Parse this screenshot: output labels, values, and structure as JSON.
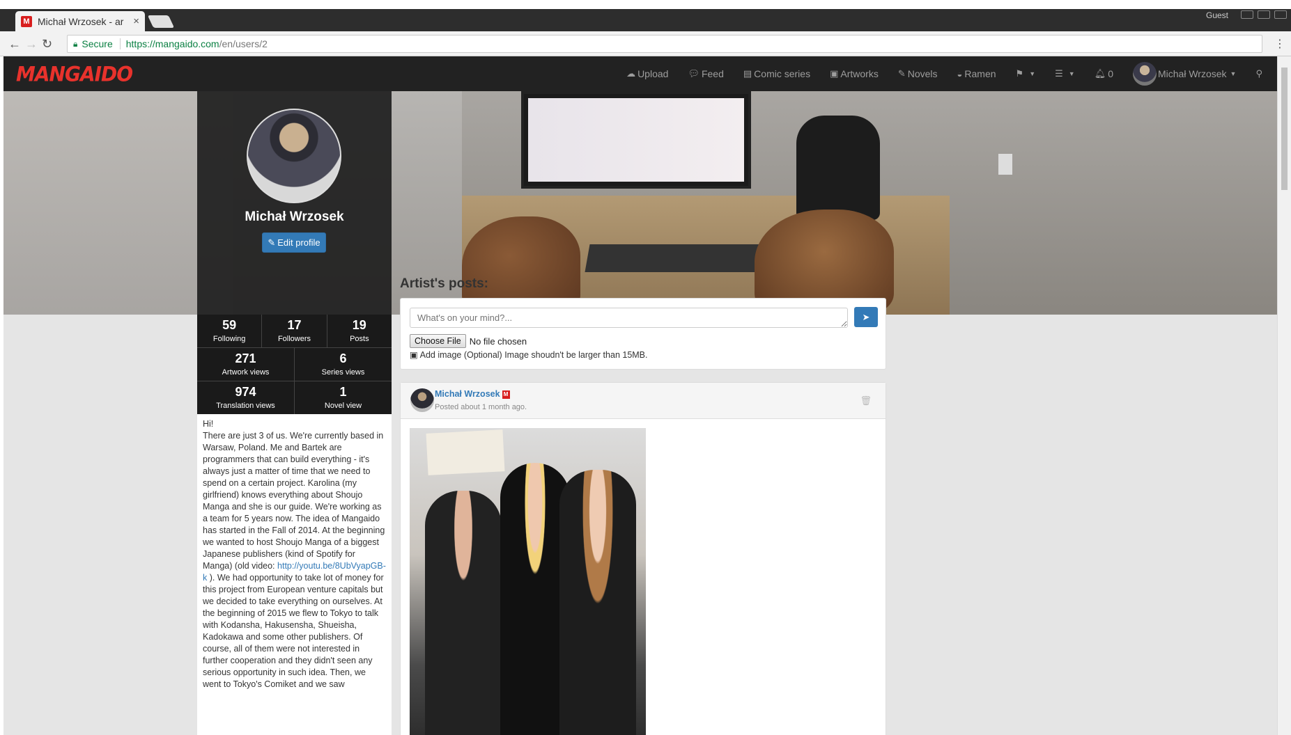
{
  "browser": {
    "tab_title": "Michał Wrzosek - ar",
    "tab_favicon": "M",
    "close_glyph": "×",
    "guest_label": "Guest",
    "secure_label": "Secure",
    "url_host": "https://mangaido.com",
    "url_path": "/en/users/2"
  },
  "nav": {
    "logo": "MANGAIDO",
    "items": [
      {
        "icon": "upload-icon",
        "label": "Upload"
      },
      {
        "icon": "feed-icon",
        "label": "Feed"
      },
      {
        "icon": "book-icon",
        "label": "Comic series"
      },
      {
        "icon": "image-icon",
        "label": "Artworks"
      },
      {
        "icon": "edit-icon",
        "label": "Novels"
      },
      {
        "icon": "ramen-icon",
        "label": "Ramen"
      }
    ],
    "notifications_count": "0",
    "user_name": "Michał Wrzosek"
  },
  "profile": {
    "name": "Michał Wrzosek",
    "edit_label": "Edit profile",
    "stats_row1": [
      {
        "num": "59",
        "label": "Following"
      },
      {
        "num": "17",
        "label": "Followers"
      },
      {
        "num": "19",
        "label": "Posts"
      }
    ],
    "stats_row2": [
      {
        "num": "271",
        "label": "Artwork views"
      },
      {
        "num": "6",
        "label": "Series views"
      }
    ],
    "stats_row3": [
      {
        "num": "974",
        "label": "Translation views"
      },
      {
        "num": "1",
        "label": "Novel view"
      }
    ],
    "bio_greeting": "Hi!",
    "bio_part1": "There are just 3 of us. We're currently based in Warsaw, Poland. Me and Bartek are programmers that can build everything - it's always just a matter of time that we need to spend on a certain project. Karolina (my girlfriend) knows everything about Shoujo Manga and she is our guide. We're working as a team for 5 years now. The idea of Mangaido has started in the Fall of 2014. At the beginning we wanted to host Shoujo Manga of a biggest Japanese publishers (kind of Spotify for Manga) (old video: ",
    "bio_link": "http://youtu.be/8UbVyapGB-k",
    "bio_part2": " ). We had opportunity to take lot of money for this project from European venture capitals but we decided to take everything on ourselves. At the beginning of 2015 we flew to Tokyo to talk with Kodansha, Hakusensha, Shueisha, Kadokawa and some other publishers. Of course, all of them were not interested in further cooperation and they didn't seen any serious opportunity in such idea. Then, we went to Tokyo's Comiket and we saw"
  },
  "posts": {
    "title": "Artist's posts:",
    "compose_placeholder": "What's on your mind?...",
    "choose_file_label": "Choose File",
    "no_file_label": "No file chosen",
    "add_image_label": "Add image (Optional) Image shoudn't be larger than 15MB.",
    "post_author": "Michał Wrzosek",
    "post_badge": "M",
    "post_time": "Posted about 1 month ago."
  }
}
